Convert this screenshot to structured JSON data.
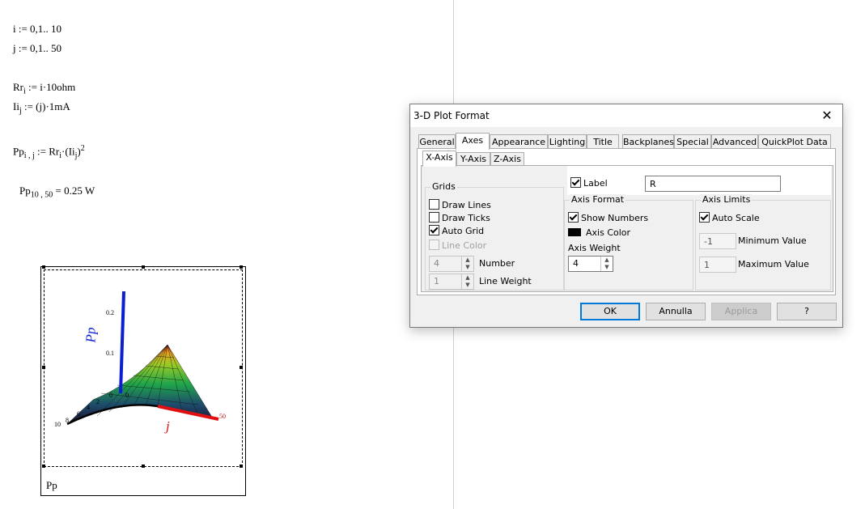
{
  "worksheet": {
    "line_i": "i := 0,1.. 10",
    "line_j": "j := 0,1.. 50",
    "rr_lhs": "Rr",
    "rr_sub": "i",
    "rr_rhs": " := i·10ohm",
    "ii_lhs": "Ii",
    "ii_sub": "j",
    "ii_rhs": " := (j)·1mA",
    "pp_lhs": "Pp",
    "pp_sub": "i , j",
    "pp_mid": " := Rr",
    "pp_mid_sub": "i",
    "pp_paren": "·(Ii",
    "pp_paren_sub": "j",
    "pp_close": ")",
    "pp_exp": "2",
    "eval_lhs": "Pp",
    "eval_sub": "10 , 50",
    "eval_rhs": " = 0.25 W"
  },
  "plot": {
    "name": "Pp",
    "z_axis_label": "Pp",
    "y_axis_label": "j",
    "z_ticks": [
      "0.2",
      "0.1",
      "0"
    ],
    "y_tick": "50",
    "x_ticks": [
      "10",
      "8",
      "6",
      "4",
      "2",
      "0"
    ],
    "colors": {
      "z_axis": "#0b1fd1",
      "y_axis": "#e01010"
    }
  },
  "dialog": {
    "title": "3-D Plot Format",
    "tabs": [
      "General",
      "Axes",
      "Appearance",
      "Lighting",
      "Title",
      "Backplanes",
      "Special",
      "Advanced",
      "QuickPlot Data"
    ],
    "active_tab": "Axes",
    "subtabs": [
      "X-Axis",
      "Y-Axis",
      "Z-Axis"
    ],
    "active_subtab": "X-Axis",
    "grids": {
      "title": "Grids",
      "draw_lines": "Draw Lines",
      "draw_ticks": "Draw Ticks",
      "auto_grid": "Auto Grid",
      "line_color": "Line Color",
      "number_value": "4",
      "number_label": "Number",
      "line_weight_value": "1",
      "line_weight_label": "Line Weight"
    },
    "label": {
      "checkbox": "Label",
      "value": "R"
    },
    "axis_format": {
      "title": "Axis Format",
      "show_numbers": "Show Numbers",
      "axis_color": "Axis Color",
      "axis_weight_label": "Axis Weight",
      "axis_weight_value": "4"
    },
    "axis_limits": {
      "title": "Axis Limits",
      "auto_scale": "Auto Scale",
      "min_value": "-1",
      "min_label": "Minimum Value",
      "max_value": "1",
      "max_label": "Maximum Value"
    },
    "buttons": {
      "ok": "OK",
      "cancel": "Annulla",
      "apply": "Applica",
      "help": "?"
    }
  }
}
